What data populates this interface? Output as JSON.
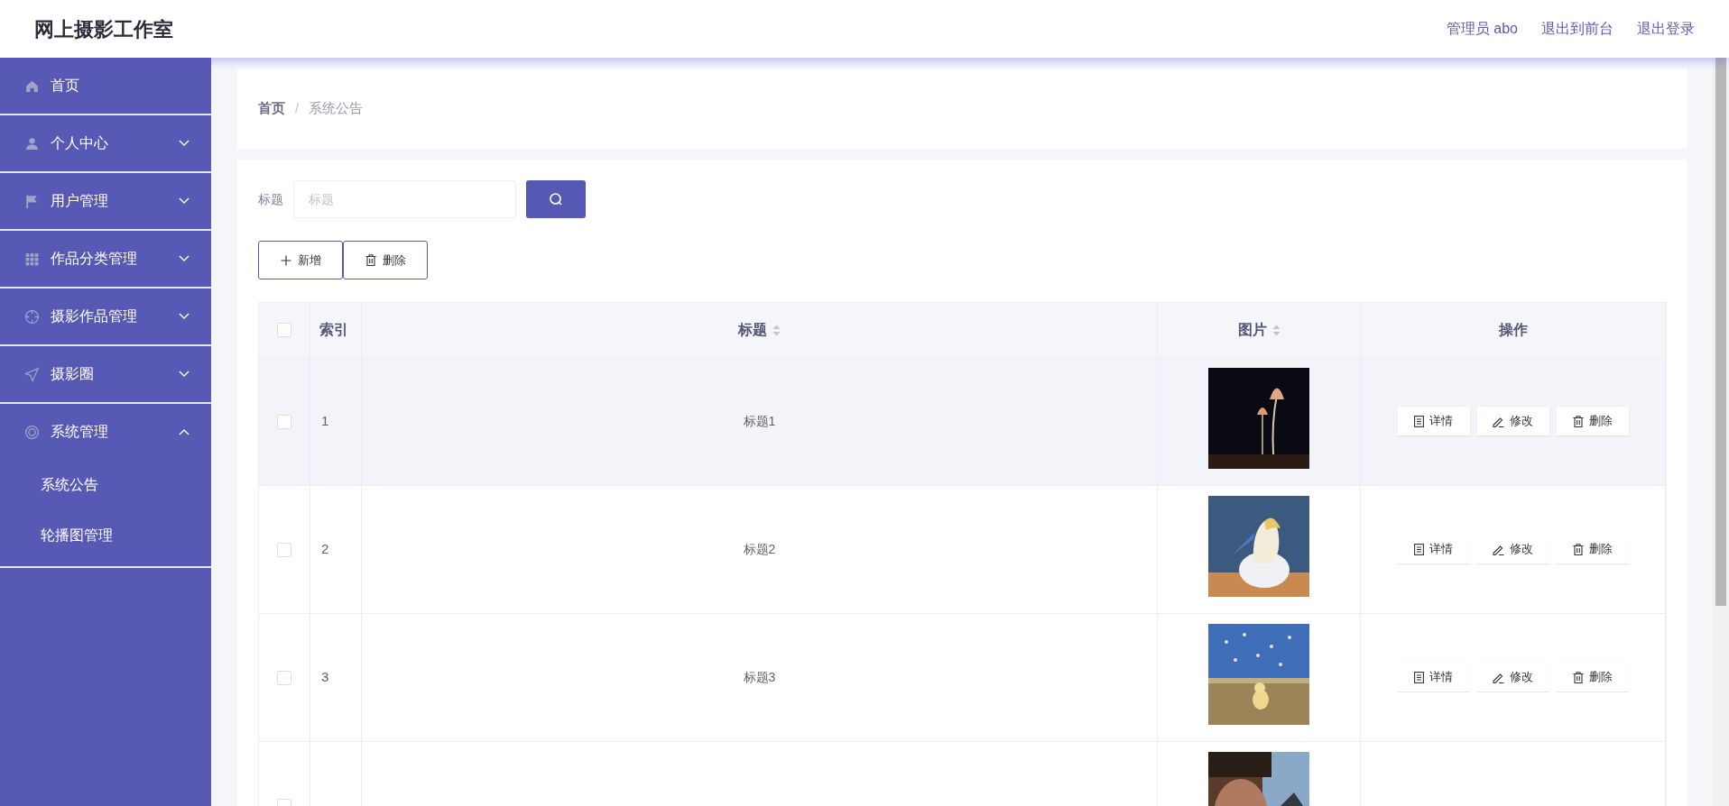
{
  "header": {
    "title": "网上摄影工作室",
    "links": [
      "管理员 abo",
      "退出到前台",
      "退出登录"
    ]
  },
  "sidebar": {
    "items": [
      {
        "label": "首页"
      },
      {
        "label": "个人中心",
        "expanded": false
      },
      {
        "label": "用户管理",
        "expanded": false
      },
      {
        "label": "作品分类管理",
        "expanded": false
      },
      {
        "label": "摄影作品管理",
        "expanded": false
      },
      {
        "label": "摄影圈",
        "expanded": false
      },
      {
        "label": "系统管理",
        "expanded": true,
        "children": [
          {
            "label": "系统公告"
          },
          {
            "label": "轮播图管理"
          }
        ]
      }
    ]
  },
  "breadcrumb": {
    "items": [
      "首页",
      "系统公告"
    ],
    "separator": "/"
  },
  "search": {
    "label": "标题",
    "placeholder": "标题"
  },
  "actions": [
    "新增",
    "删除"
  ],
  "table": {
    "select_all_checked": false,
    "columns": [
      {
        "label": "索引",
        "sortable": false
      },
      {
        "label": "标题",
        "sortable": true
      },
      {
        "label": "图片",
        "sortable": true
      },
      {
        "label": "操作",
        "sortable": false
      }
    ],
    "rows": [
      {
        "index": "1",
        "title": "标题1",
        "hovered": true,
        "checked": false,
        "buttons": [
          "详情",
          "修改",
          "删除"
        ]
      },
      {
        "index": "2",
        "title": "标题2",
        "hovered": false,
        "checked": false,
        "buttons": [
          "详情",
          "修改",
          "删除"
        ]
      },
      {
        "index": "3",
        "title": "标题3",
        "hovered": false,
        "checked": false,
        "buttons": [
          "详情",
          "修改",
          "删除"
        ]
      },
      {
        "hovered": false,
        "checked": false
      }
    ]
  }
}
